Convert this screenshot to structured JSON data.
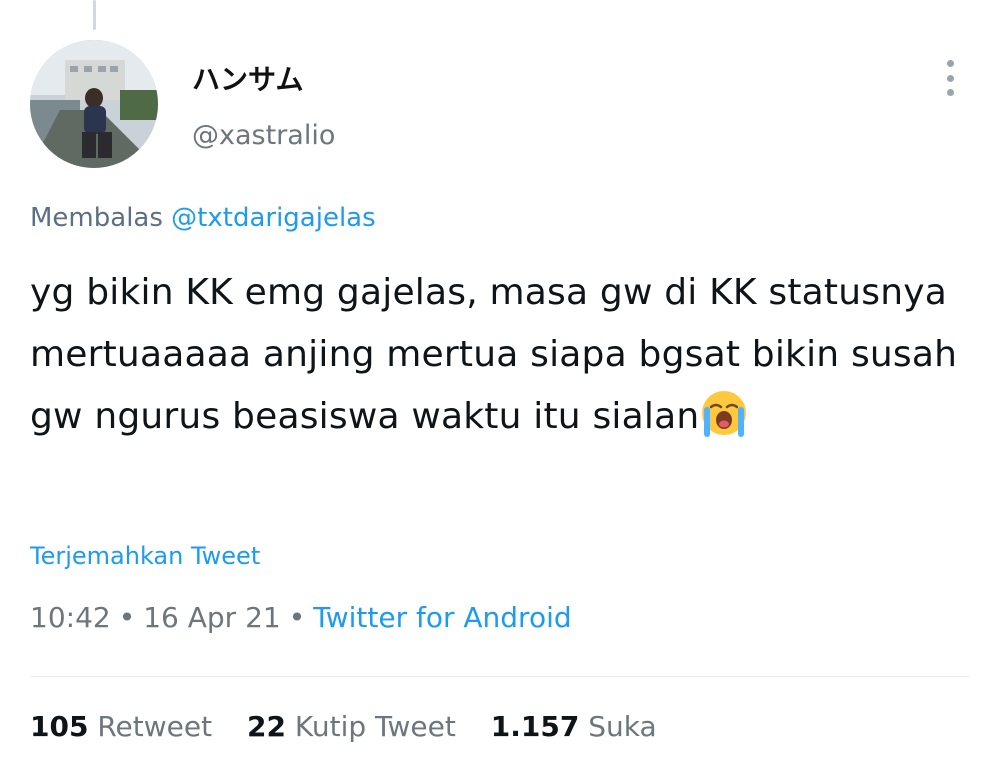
{
  "tweet": {
    "display_name": "ハンサム",
    "handle": "@xastralio",
    "reply_prefix": "Membalas",
    "reply_mention": "@txtdarigajelas",
    "text": "yg bikin KK emg gajelas, masa gw di KK statusnya mertuaaaaa anjing mertua siapa bgsat bikin susah gw ngurus beasiswa waktu itu sialan",
    "emoji": "loudly-crying-face-icon",
    "translate_label": "Terjemahkan Tweet",
    "time": "10:42",
    "date": "16 Apr 21",
    "separator": "•",
    "source": "Twitter for Android"
  },
  "stats": {
    "retweet_count": "105",
    "retweet_label": "Retweet",
    "quote_count": "22",
    "quote_label": "Kutip Tweet",
    "like_count": "1.157",
    "like_label": "Suka"
  },
  "colors": {
    "link": "#1d9bf0",
    "muted": "#6e767d",
    "text": "#0f1419"
  }
}
